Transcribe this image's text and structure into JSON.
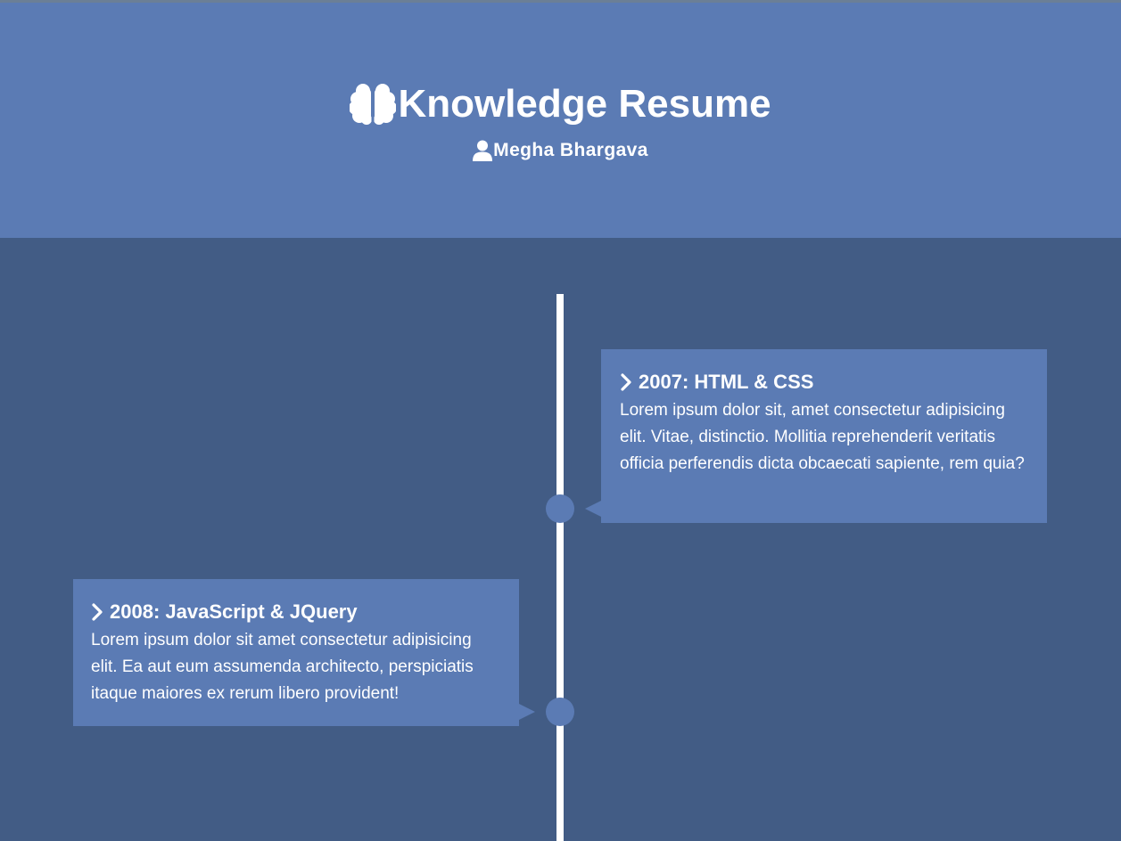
{
  "header": {
    "title": "Knowledge Resume",
    "subtitle": "Megha Bhargava",
    "title_icon": "brain-icon",
    "subtitle_icon": "user-icon"
  },
  "colors": {
    "page_background": "#425c85",
    "header_background": "#5b7bb4",
    "card_background": "#5b7bb4",
    "timeline_line": "#ffffff",
    "text": "#ffffff"
  },
  "timeline": {
    "entries": [
      {
        "icon": "chevron-right-icon",
        "title": "2007: HTML & CSS",
        "text": "Lorem ipsum dolor sit, amet consectetur adipisicing elit. Vitae, distinctio. Mollitia reprehenderit veritatis officia perferendis dicta obcaecati sapiente, rem quia?"
      },
      {
        "icon": "chevron-right-icon",
        "title": "2008: JavaScript & JQuery",
        "text": "Lorem ipsum dolor sit amet consectetur adipisicing elit. Ea aut eum assumenda architecto, perspiciatis itaque maiores ex rerum libero provident!"
      }
    ]
  }
}
